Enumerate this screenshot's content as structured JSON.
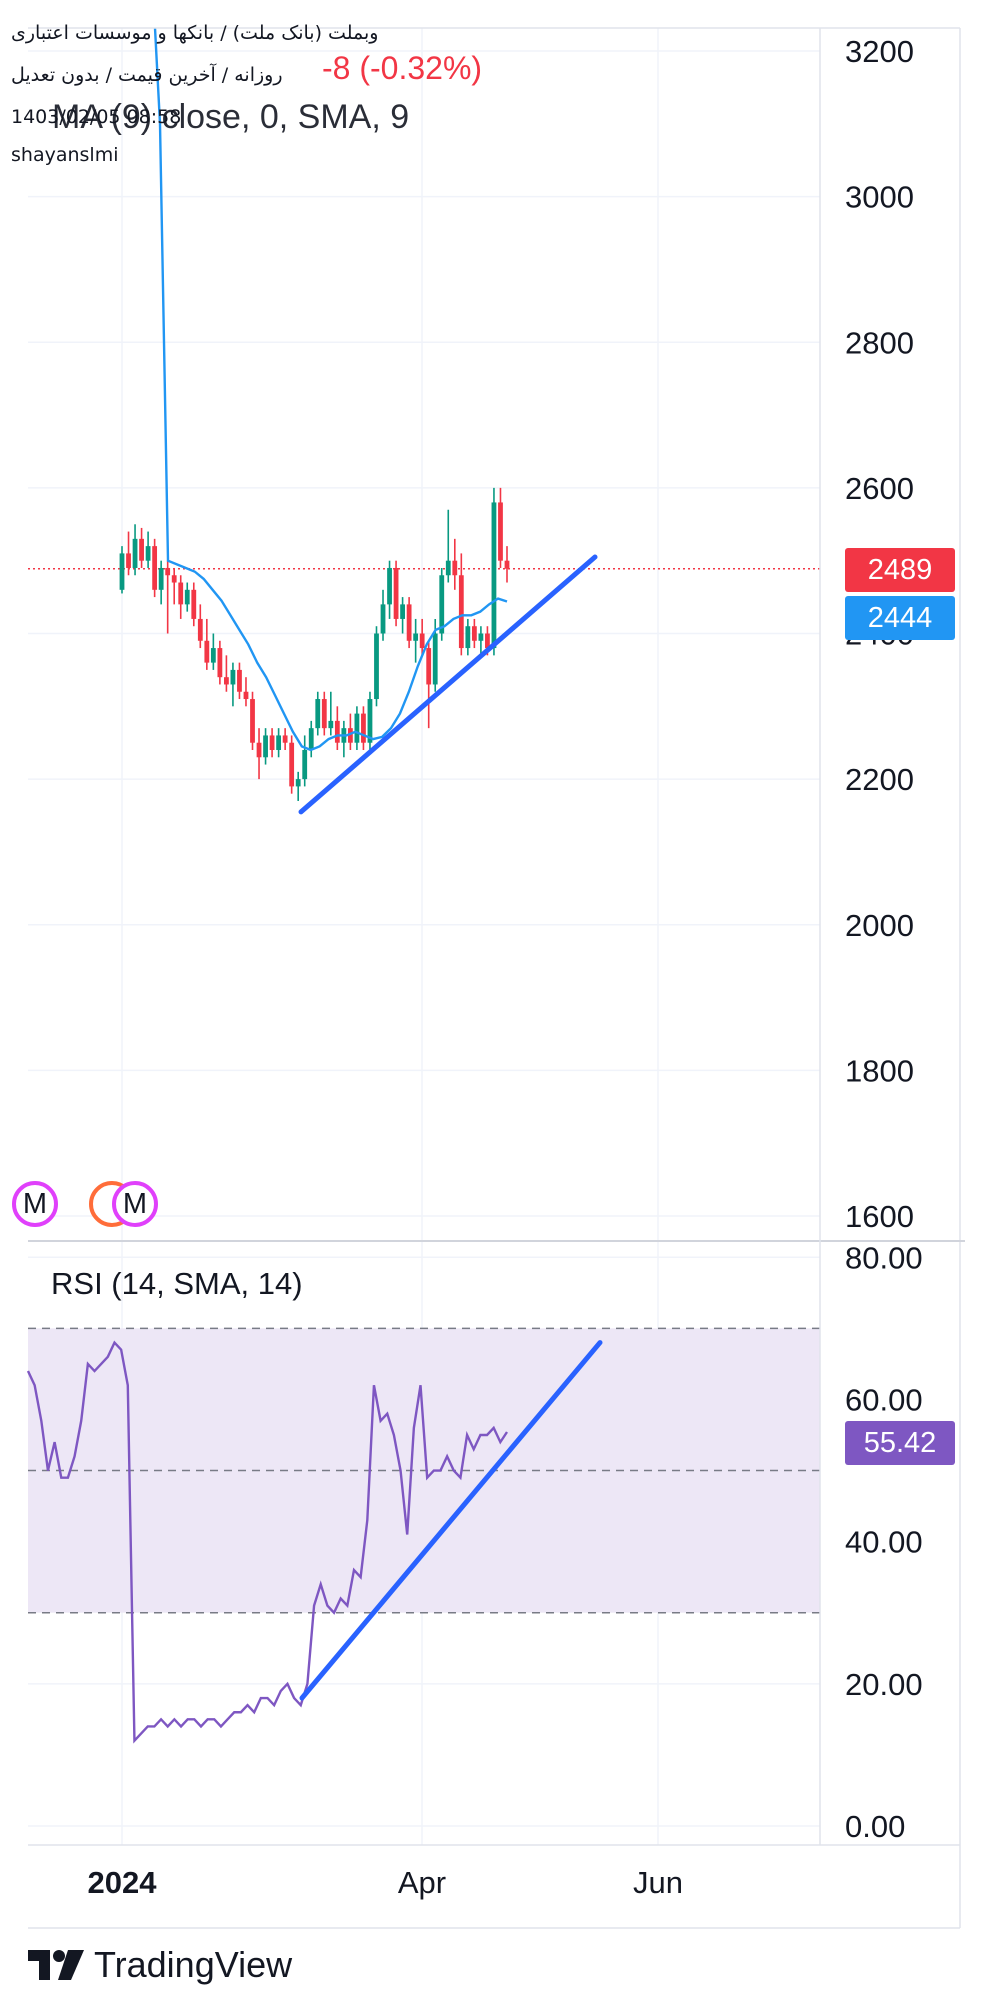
{
  "header": {
    "symbol_line": "وبملت (بانک ملت) / بانکها و موسسات اعتباری",
    "settings_line": "روزانه / آخرین قیمت / بدون تعدیل",
    "datetime": "1403/02/05 08:58",
    "author": "shayanslmi",
    "price_change": "-8 (-0.32%)",
    "indicator_label": "MA (9) close, 0, SMA, 9"
  },
  "colors": {
    "up": "#089981",
    "down": "#f23645",
    "ma": "#2196f3",
    "trendline": "#2962ff",
    "rsi": "#7e57c2",
    "rsi_band": "#ede7f6",
    "grid": "#f0f3fa"
  },
  "badges": {
    "last_price": "2489",
    "ma_value": "2444",
    "rsi_value": "55.42"
  },
  "rsi_panel": {
    "title": "RSI (14, SMA, 14)"
  },
  "markers": [
    "M",
    "M"
  ],
  "brand": {
    "name": "TradingView"
  },
  "chart_data": [
    {
      "type": "candlestick",
      "title": "",
      "x_axis": {
        "ticks": [
          "2024",
          "Apr",
          "Jun"
        ]
      },
      "y_axis": {
        "ticks": [
          1600,
          1800,
          2000,
          2200,
          2400,
          2600,
          2800,
          3000,
          3200
        ],
        "ylim": [
          1600,
          3230
        ]
      },
      "last_price": 2489,
      "last_price_line": "dotted-red",
      "candles": [
        {
          "o": 2460,
          "h": 2520,
          "l": 2455,
          "c": 2510
        },
        {
          "o": 2510,
          "h": 2540,
          "l": 2480,
          "c": 2490
        },
        {
          "o": 2490,
          "h": 2550,
          "l": 2480,
          "c": 2530
        },
        {
          "o": 2530,
          "h": 2545,
          "l": 2490,
          "c": 2500
        },
        {
          "o": 2500,
          "h": 2540,
          "l": 2490,
          "c": 2520
        },
        {
          "o": 2520,
          "h": 2530,
          "l": 2450,
          "c": 2460
        },
        {
          "o": 2460,
          "h": 2500,
          "l": 2440,
          "c": 2490
        },
        {
          "o": 2490,
          "h": 2500,
          "l": 2400,
          "c": 2480
        },
        {
          "o": 2480,
          "h": 2490,
          "l": 2440,
          "c": 2470
        },
        {
          "o": 2470,
          "h": 2480,
          "l": 2420,
          "c": 2440
        },
        {
          "o": 2440,
          "h": 2470,
          "l": 2430,
          "c": 2460
        },
        {
          "o": 2460,
          "h": 2470,
          "l": 2410,
          "c": 2420
        },
        {
          "o": 2420,
          "h": 2440,
          "l": 2380,
          "c": 2390
        },
        {
          "o": 2390,
          "h": 2420,
          "l": 2350,
          "c": 2360
        },
        {
          "o": 2360,
          "h": 2400,
          "l": 2350,
          "c": 2380
        },
        {
          "o": 2380,
          "h": 2390,
          "l": 2330,
          "c": 2340
        },
        {
          "o": 2340,
          "h": 2370,
          "l": 2320,
          "c": 2330
        },
        {
          "o": 2330,
          "h": 2360,
          "l": 2300,
          "c": 2350
        },
        {
          "o": 2350,
          "h": 2360,
          "l": 2310,
          "c": 2320
        },
        {
          "o": 2320,
          "h": 2340,
          "l": 2300,
          "c": 2310
        },
        {
          "o": 2310,
          "h": 2320,
          "l": 2240,
          "c": 2250
        },
        {
          "o": 2250,
          "h": 2270,
          "l": 2200,
          "c": 2230
        },
        {
          "o": 2230,
          "h": 2270,
          "l": 2220,
          "c": 2260
        },
        {
          "o": 2260,
          "h": 2270,
          "l": 2230,
          "c": 2240
        },
        {
          "o": 2240,
          "h": 2270,
          "l": 2230,
          "c": 2260
        },
        {
          "o": 2260,
          "h": 2270,
          "l": 2240,
          "c": 2250
        },
        {
          "o": 2250,
          "h": 2260,
          "l": 2180,
          "c": 2190
        },
        {
          "o": 2190,
          "h": 2210,
          "l": 2170,
          "c": 2200
        },
        {
          "o": 2200,
          "h": 2260,
          "l": 2190,
          "c": 2240
        },
        {
          "o": 2240,
          "h": 2280,
          "l": 2230,
          "c": 2270
        },
        {
          "o": 2270,
          "h": 2320,
          "l": 2260,
          "c": 2310
        },
        {
          "o": 2310,
          "h": 2320,
          "l": 2260,
          "c": 2270
        },
        {
          "o": 2270,
          "h": 2320,
          "l": 2260,
          "c": 2280
        },
        {
          "o": 2280,
          "h": 2300,
          "l": 2240,
          "c": 2250
        },
        {
          "o": 2250,
          "h": 2280,
          "l": 2230,
          "c": 2270
        },
        {
          "o": 2270,
          "h": 2290,
          "l": 2240,
          "c": 2250
        },
        {
          "o": 2250,
          "h": 2300,
          "l": 2240,
          "c": 2290
        },
        {
          "o": 2290,
          "h": 2300,
          "l": 2240,
          "c": 2250
        },
        {
          "o": 2250,
          "h": 2320,
          "l": 2240,
          "c": 2310
        },
        {
          "o": 2310,
          "h": 2410,
          "l": 2300,
          "c": 2400
        },
        {
          "o": 2400,
          "h": 2460,
          "l": 2390,
          "c": 2440
        },
        {
          "o": 2440,
          "h": 2500,
          "l": 2420,
          "c": 2490
        },
        {
          "o": 2490,
          "h": 2500,
          "l": 2410,
          "c": 2420
        },
        {
          "o": 2420,
          "h": 2450,
          "l": 2400,
          "c": 2440
        },
        {
          "o": 2440,
          "h": 2450,
          "l": 2380,
          "c": 2390
        },
        {
          "o": 2390,
          "h": 2420,
          "l": 2360,
          "c": 2400
        },
        {
          "o": 2400,
          "h": 2420,
          "l": 2370,
          "c": 2380
        },
        {
          "o": 2380,
          "h": 2390,
          "l": 2270,
          "c": 2330
        },
        {
          "o": 2330,
          "h": 2420,
          "l": 2320,
          "c": 2400
        },
        {
          "o": 2400,
          "h": 2490,
          "l": 2390,
          "c": 2480
        },
        {
          "o": 2480,
          "h": 2570,
          "l": 2470,
          "c": 2500
        },
        {
          "o": 2500,
          "h": 2530,
          "l": 2460,
          "c": 2480
        },
        {
          "o": 2480,
          "h": 2510,
          "l": 2370,
          "c": 2380
        },
        {
          "o": 2380,
          "h": 2420,
          "l": 2370,
          "c": 2410
        },
        {
          "o": 2410,
          "h": 2420,
          "l": 2380,
          "c": 2390
        },
        {
          "o": 2390,
          "h": 2410,
          "l": 2370,
          "c": 2400
        },
        {
          "o": 2400,
          "h": 2410,
          "l": 2370,
          "c": 2380
        },
        {
          "o": 2380,
          "h": 2600,
          "l": 2370,
          "c": 2580
        },
        {
          "o": 2580,
          "h": 2600,
          "l": 2490,
          "c": 2500
        },
        {
          "o": 2500,
          "h": 2520,
          "l": 2470,
          "c": 2489
        }
      ],
      "series": [
        {
          "name": "MA (9)",
          "values": [
            3100,
            2500,
            2495,
            2490,
            2485,
            2475,
            2460,
            2445,
            2425,
            2405,
            2385,
            2360,
            2340,
            2315,
            2290,
            2265,
            2245,
            2240,
            2245,
            2255,
            2260,
            2260,
            2265,
            2260,
            2255,
            2258,
            2270,
            2290,
            2320,
            2355,
            2385,
            2405,
            2410,
            2420,
            2425,
            2425,
            2430,
            2440,
            2448,
            2444
          ]
        }
      ],
      "trendline": {
        "from": 2155,
        "to": 2505
      }
    },
    {
      "type": "line",
      "title": "RSI (14, SMA, 14)",
      "y_axis": {
        "ticks": [
          0,
          20,
          40,
          60,
          80
        ],
        "ylim": [
          0,
          81
        ]
      },
      "band": [
        30,
        70
      ],
      "levels": [
        30,
        50,
        70
      ],
      "series": [
        {
          "name": "RSI",
          "values": [
            64,
            62,
            57,
            50,
            54,
            49,
            49,
            52,
            57,
            65,
            64,
            65,
            66,
            68,
            67,
            62,
            12,
            13,
            14,
            14,
            15,
            14,
            15,
            14,
            15,
            15,
            14,
            15,
            15,
            14,
            15,
            16,
            16,
            17,
            16,
            18,
            18,
            17,
            19,
            20,
            18,
            17,
            20,
            31,
            34,
            31,
            30,
            32,
            31,
            36,
            35,
            43,
            62,
            57,
            58,
            55,
            50,
            41,
            56,
            62,
            49,
            50,
            50,
            52,
            50,
            49,
            55,
            53,
            55,
            55,
            56,
            54,
            55.42
          ],
          "last": 55.42
        }
      ],
      "trendline": {
        "from": 18,
        "to": 68
      }
    }
  ]
}
